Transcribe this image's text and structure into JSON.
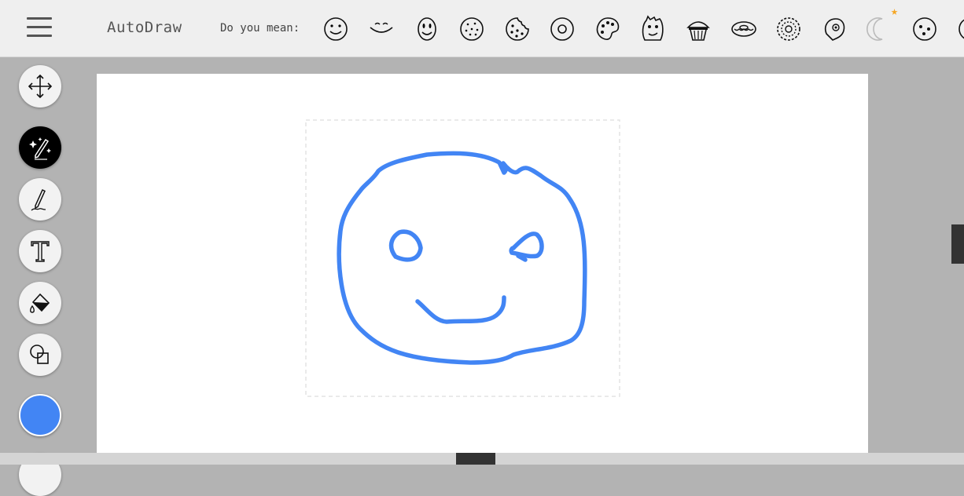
{
  "app": {
    "title": "AutoDraw"
  },
  "suggestions": {
    "label": "Do you mean:",
    "items": [
      "smiley",
      "smile",
      "face",
      "cookie",
      "cookie-bite",
      "donut",
      "paint-palette",
      "monster",
      "cupcake",
      "donut-side",
      "flower",
      "face-profile",
      "moon",
      "button"
    ]
  },
  "tools": [
    "select",
    "autodraw",
    "draw",
    "type",
    "fill",
    "shape"
  ],
  "colors": {
    "accent": "#4285f4",
    "stroke": "#4285f4",
    "active_tool": "#000000"
  }
}
